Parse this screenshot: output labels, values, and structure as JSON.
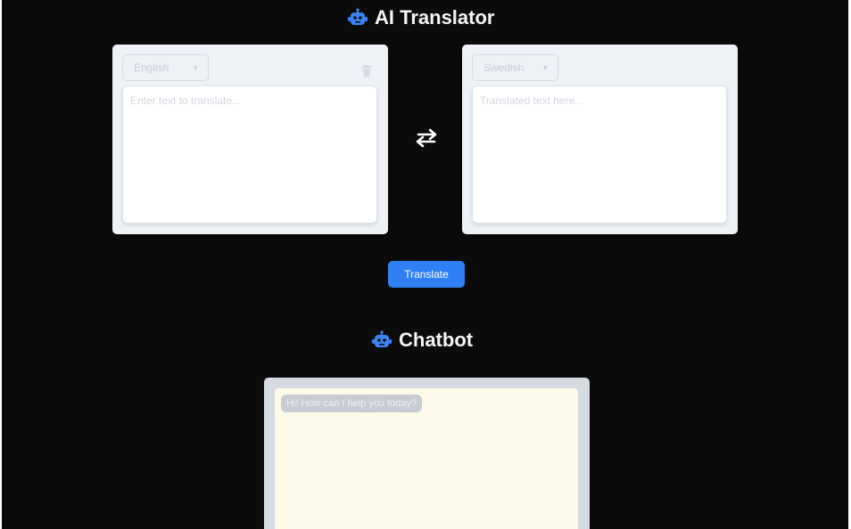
{
  "translator": {
    "title": "AI Translator",
    "icon": "robot-icon",
    "source": {
      "language": "English",
      "placeholder": "Enter text to translate..."
    },
    "target": {
      "language": "Swedish",
      "placeholder": "Translated text here..."
    },
    "swap_icon": "swap-arrows-icon",
    "clear_icon": "trash-icon",
    "translate_label": "Translate"
  },
  "chatbot": {
    "title": "Chatbot",
    "icon": "robot-icon",
    "messages": [
      {
        "from": "bot",
        "text": "Hi! How can I help you today?"
      }
    ]
  },
  "colors": {
    "background": "#0b0b0b",
    "accent": "#2f80f4",
    "panel": "#eef2f7",
    "chat_bg": "#fdf9e8"
  }
}
